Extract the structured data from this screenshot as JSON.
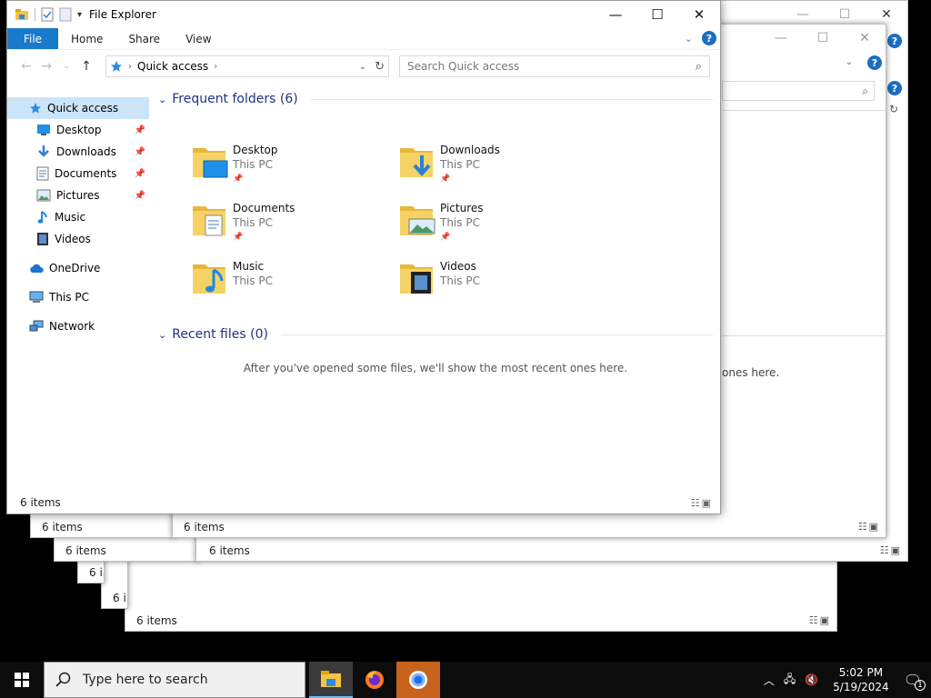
{
  "window": {
    "title": "File Explorer",
    "minimize": "—",
    "maximize": "☐",
    "close": "✕"
  },
  "ribbon": {
    "file": "File",
    "tabs": [
      "Home",
      "Share",
      "View"
    ],
    "help": "?"
  },
  "address": {
    "location": "Quick access",
    "search_placeholder": "Search Quick access"
  },
  "sidebar": {
    "quick_access": "Quick access",
    "pinned": [
      {
        "label": "Desktop",
        "icon": "desktop-icon",
        "pinned": true
      },
      {
        "label": "Downloads",
        "icon": "downloads-icon",
        "pinned": true
      },
      {
        "label": "Documents",
        "icon": "documents-icon",
        "pinned": true
      },
      {
        "label": "Pictures",
        "icon": "pictures-icon",
        "pinned": true
      },
      {
        "label": "Music",
        "icon": "music-icon",
        "pinned": false
      },
      {
        "label": "Videos",
        "icon": "videos-icon",
        "pinned": false
      }
    ],
    "onedrive": "OneDrive",
    "this_pc": "This PC",
    "network": "Network"
  },
  "frequent": {
    "header": "Frequent folders (6)",
    "folders": [
      {
        "name": "Desktop",
        "location": "This PC",
        "pinned": true
      },
      {
        "name": "Downloads",
        "location": "This PC",
        "pinned": true
      },
      {
        "name": "Documents",
        "location": "This PC",
        "pinned": true
      },
      {
        "name": "Pictures",
        "location": "This PC",
        "pinned": true
      },
      {
        "name": "Music",
        "location": "This PC",
        "pinned": false
      },
      {
        "name": "Videos",
        "location": "This PC",
        "pinned": false
      }
    ]
  },
  "recent": {
    "header": "Recent files (0)",
    "empty": "After you've opened some files, we'll show the most recent ones here."
  },
  "status": {
    "items": "6 items"
  },
  "background": {
    "status": "6 items",
    "peek_text": "ones here."
  },
  "taskbar": {
    "search_placeholder": "Type here to search",
    "time": "5:02 PM",
    "date": "5/19/2024",
    "notification_count": "1"
  },
  "colors": {
    "accent": "#1979ca",
    "selection": "#cce4f7",
    "heading": "#1e3287",
    "folder": "#f4c542"
  }
}
